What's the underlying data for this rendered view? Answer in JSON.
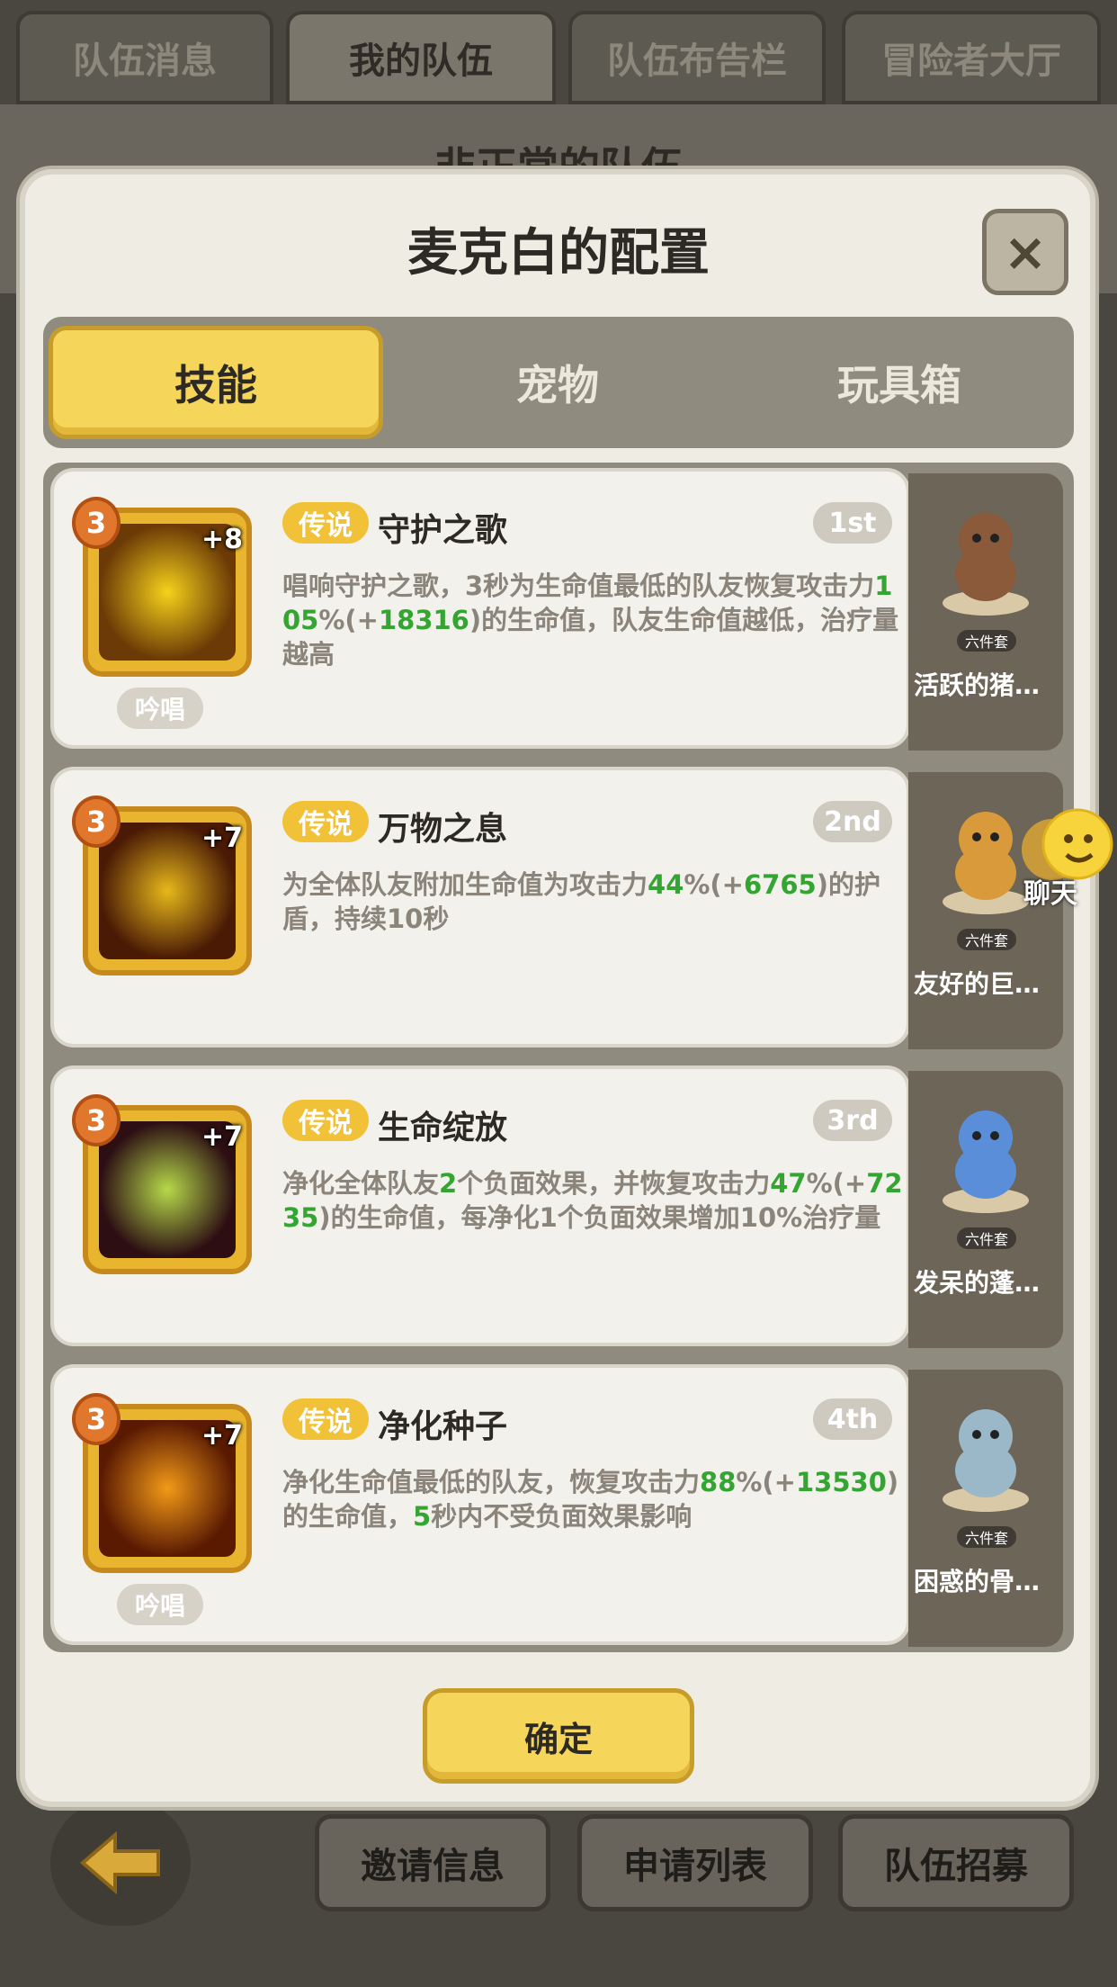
{
  "top_tabs": [
    "队伍消息",
    "我的队伍",
    "队伍布告栏",
    "冒险者大厅"
  ],
  "background_title": "非正常的队伍",
  "dialog": {
    "title": "麦克白的配置",
    "close_symbol": "×",
    "tabs": [
      "技能",
      "宠物",
      "玩具箱"
    ],
    "confirm_label": "确定"
  },
  "skills": [
    {
      "level": "3",
      "plus": "+8",
      "rarity": "传说",
      "name": "守护之歌",
      "rank": "1st",
      "chant": "吟唱",
      "desc": [
        [
          "唱响守护之歌，3秒为生命值最低的队友恢复攻击力",
          ""
        ],
        [
          "105",
          "g"
        ],
        [
          "%(+",
          ""
        ],
        [
          "18316",
          "g"
        ],
        [
          ")的生命值，队友生命值越低，治疗量越高",
          ""
        ]
      ],
      "pet_set": "六件套",
      "pet_name": "活跃的猪…"
    },
    {
      "level": "3",
      "plus": "+7",
      "rarity": "传说",
      "name": "万物之息",
      "rank": "2nd",
      "chant": "",
      "desc": [
        [
          "为全体队友附加生命值为攻击力",
          ""
        ],
        [
          "44",
          "g"
        ],
        [
          "%(+",
          ""
        ],
        [
          "6765",
          "g"
        ],
        [
          ")的护盾，持续10秒",
          ""
        ]
      ],
      "pet_set": "六件套",
      "pet_name": "友好的巨…"
    },
    {
      "level": "3",
      "plus": "+7",
      "rarity": "传说",
      "name": "生命绽放",
      "rank": "3rd",
      "chant": "",
      "desc": [
        [
          "净化全体队友",
          ""
        ],
        [
          "2",
          "g"
        ],
        [
          "个负面效果，并恢复攻击力",
          ""
        ],
        [
          "47",
          "g"
        ],
        [
          "%(+",
          ""
        ],
        [
          "7235",
          "g"
        ],
        [
          ")的生命值，每净化1个负面效果增加10%治疗量",
          ""
        ]
      ],
      "pet_set": "六件套",
      "pet_name": "发呆的蓬…"
    },
    {
      "level": "3",
      "plus": "+7",
      "rarity": "传说",
      "name": "净化种子",
      "rank": "4th",
      "chant": "吟唱",
      "desc": [
        [
          "净化生命值最低的队友，恢复攻击力",
          ""
        ],
        [
          "88",
          "g"
        ],
        [
          "%(+",
          ""
        ],
        [
          "13530",
          "g"
        ],
        [
          ")的生命值，",
          ""
        ],
        [
          "5",
          "g"
        ],
        [
          "秒内不受负面效果影响",
          ""
        ]
      ],
      "pet_set": "六件套",
      "pet_name": "困惑的骨…"
    }
  ],
  "chat_label": "聊天",
  "bottom_buttons": [
    "邀请信息",
    "申请列表",
    "队伍招募"
  ]
}
